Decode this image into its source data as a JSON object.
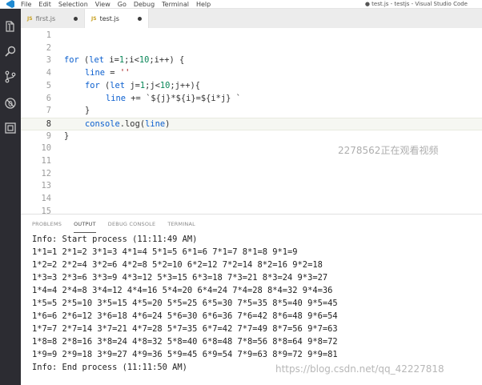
{
  "menu": {
    "items": [
      "File",
      "Edit",
      "Selection",
      "View",
      "Go",
      "Debug",
      "Terminal",
      "Help"
    ],
    "window_title": "● test.js - testjs - Visual Studio Code"
  },
  "tabs": [
    {
      "icon": "JS",
      "label": "first.js",
      "dirty": true
    },
    {
      "icon": "JS",
      "label": "test.js",
      "dirty": true
    }
  ],
  "editor": {
    "line_numbers": [
      "1",
      "2",
      "3",
      "4",
      "5",
      "6",
      "7",
      "8",
      "9",
      "10",
      "11",
      "12",
      "13",
      "14",
      "15"
    ],
    "current_line": 8,
    "code": {
      "l3": {
        "kw1": "for",
        "p1": " (",
        "kw2": "let",
        "p2": " i=",
        "n1": "1",
        "p3": ";i<",
        "n2": "10",
        "p4": ";i++) {"
      },
      "l4": {
        "var": "line",
        "p1": " = ",
        "str": "''"
      },
      "l5": {
        "kw1": "for",
        "p1": " (",
        "kw2": "let",
        "p2": " j=",
        "n1": "1",
        "p3": ";j<",
        "n2": "10",
        "p4": ";j++){"
      },
      "l6": {
        "var": "line",
        "p1": " += ",
        "tpl": "`${j}*${i}=${i*j} `"
      },
      "l7": {
        "p1": "}"
      },
      "l8": {
        "var": "console",
        "p1": ".log(",
        "arg": "line",
        "p2": ")"
      },
      "l9": {
        "p1": "}"
      }
    },
    "watermark": "2278562正在观看视频"
  },
  "panel": {
    "tabs": [
      "PROBLEMS",
      "OUTPUT",
      "DEBUG CONSOLE",
      "TERMINAL"
    ],
    "active_tab": "OUTPUT",
    "output": [
      "Info: Start process (11:11:49 AM)",
      "1*1=1 2*1=2 3*1=3 4*1=4 5*1=5 6*1=6 7*1=7 8*1=8 9*1=9",
      "1*2=2 2*2=4 3*2=6 4*2=8 5*2=10 6*2=12 7*2=14 8*2=16 9*2=18",
      "1*3=3 2*3=6 3*3=9 4*3=12 5*3=15 6*3=18 7*3=21 8*3=24 9*3=27",
      "1*4=4 2*4=8 3*4=12 4*4=16 5*4=20 6*4=24 7*4=28 8*4=32 9*4=36",
      "1*5=5 2*5=10 3*5=15 4*5=20 5*5=25 6*5=30 7*5=35 8*5=40 9*5=45",
      "1*6=6 2*6=12 3*6=18 4*6=24 5*6=30 6*6=36 7*6=42 8*6=48 9*6=54",
      "1*7=7 2*7=14 3*7=21 4*7=28 5*7=35 6*7=42 7*7=49 8*7=56 9*7=63",
      "1*8=8 2*8=16 3*8=24 4*8=32 5*8=40 6*8=48 7*8=56 8*8=64 9*8=72",
      "1*9=9 2*9=18 3*9=27 4*9=36 5*9=45 6*9=54 7*9=63 8*9=72 9*9=81",
      "Info: End process (11:11:50 AM)"
    ],
    "credit": "https://blog.csdn.net/qq_42227818"
  },
  "colors": {
    "keyword": "#0b5fcf",
    "number": "#098658",
    "string": "#a31515",
    "activity_bar": "#2c2c32",
    "js_icon": "#c7a020"
  },
  "icons": [
    "vscode-logo-icon",
    "explorer-icon",
    "search-icon",
    "source-control-icon",
    "debug-icon",
    "extensions-icon"
  ]
}
